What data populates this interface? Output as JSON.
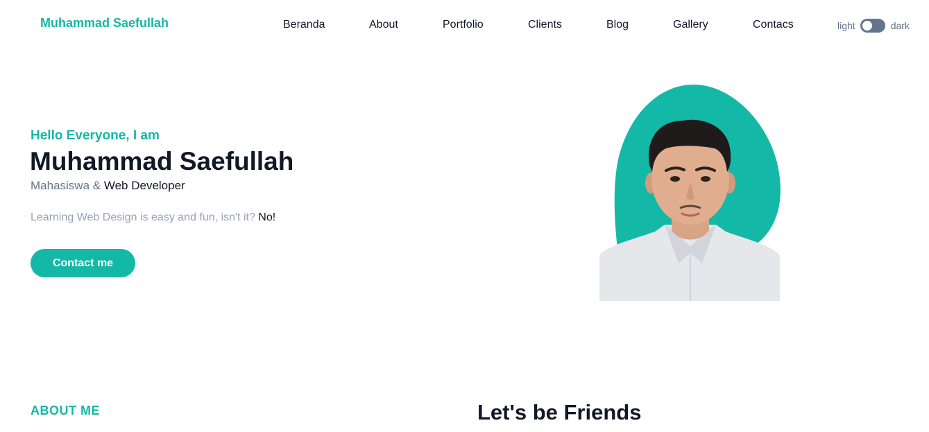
{
  "brand": {
    "name": "Muhammad Saefullah"
  },
  "nav": {
    "items": [
      {
        "label": "Beranda"
      },
      {
        "label": "About"
      },
      {
        "label": "Portfolio"
      },
      {
        "label": "Clients"
      },
      {
        "label": "Blog"
      },
      {
        "label": "Gallery"
      },
      {
        "label": "Contacs"
      }
    ]
  },
  "theme_toggle": {
    "light_label": "light",
    "dark_label": "dark",
    "state": "light"
  },
  "hero": {
    "greeting": "Hello Everyone, I am",
    "name": "Muhammad Saefullah",
    "role_prefix": "Mahasiswa &",
    "role_accent": "Web Developer",
    "tagline_text": "Learning Web Design is easy and fun, isn't it?",
    "tagline_accent": "No!",
    "cta_label": "Contact me"
  },
  "about": {
    "title": "ABOUT ME"
  },
  "friends": {
    "title": "Let's be Friends"
  },
  "colors": {
    "accent": "#14b8a6",
    "text_dark": "#111827",
    "text_muted": "#64748b",
    "text_light": "#94a3b8"
  }
}
